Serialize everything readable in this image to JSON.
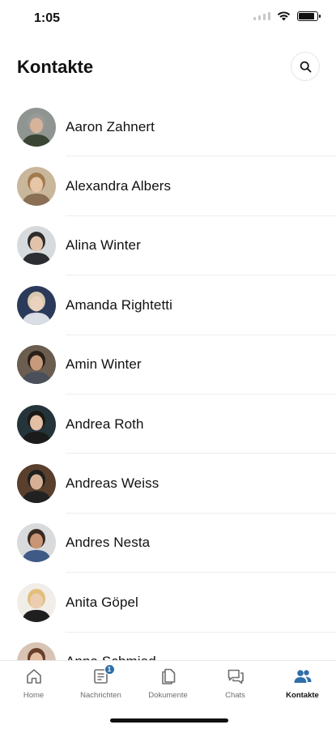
{
  "status_bar": {
    "time": "1:05"
  },
  "header": {
    "title": "Kontakte"
  },
  "contacts": [
    {
      "name": "Aaron Zahnert",
      "bg": "#8f9590",
      "skin": "#d6b49c",
      "hair": "#9a9a98",
      "shirt": "#3a4535"
    },
    {
      "name": "Alexandra Albers",
      "bg": "#c9b79c",
      "skin": "#e7c6a8",
      "hair": "#a27a4e",
      "shirt": "#8a6f55"
    },
    {
      "name": "Alina Winter",
      "bg": "#d7dadd",
      "skin": "#e1c3ab",
      "hair": "#2f2c2a",
      "shirt": "#2b2d33"
    },
    {
      "name": "Amanda Rightetti",
      "bg": "#2b3a5a",
      "skin": "#ead2bf",
      "hair": "#d8c8ad",
      "shirt": "#d9dde4"
    },
    {
      "name": "Amin Winter",
      "bg": "#6b5d4f",
      "skin": "#c69a7a",
      "hair": "#2a1f18",
      "shirt": "#4a4f5a"
    },
    {
      "name": "Andrea Roth",
      "bg": "#24343a",
      "skin": "#e3bfa4",
      "hair": "#1b1816",
      "shirt": "#1b1b1b"
    },
    {
      "name": "Andreas Weiss",
      "bg": "#5a3f2d",
      "skin": "#d7b094",
      "hair": "#1e1e1e",
      "shirt": "#222222"
    },
    {
      "name": "Andres Nesta",
      "bg": "#d8dadc",
      "skin": "#c99574",
      "hair": "#3a2b22",
      "shirt": "#3f5a87"
    },
    {
      "name": "Anita Göpel",
      "bg": "#f1ede8",
      "skin": "#ebcdb2",
      "hair": "#e2bf78",
      "shirt": "#1f1f1f"
    },
    {
      "name": "Anna Schmied",
      "bg": "#d9c3b4",
      "skin": "#e5bfa4",
      "hair": "#6a3f2a",
      "shirt": "#b6a090"
    }
  ],
  "tabs": [
    {
      "label": "Home",
      "icon": "home-icon"
    },
    {
      "label": "Nachrichten",
      "icon": "news-icon",
      "badge": "1"
    },
    {
      "label": "Dokumente",
      "icon": "documents-icon"
    },
    {
      "label": "Chats",
      "icon": "chats-icon"
    },
    {
      "label": "Kontakte",
      "icon": "contacts-icon",
      "active": true
    }
  ],
  "colors": {
    "accent": "#2e6fa8",
    "text": "#111111",
    "muted": "#6e6e6e",
    "divider": "#eeeeee"
  }
}
